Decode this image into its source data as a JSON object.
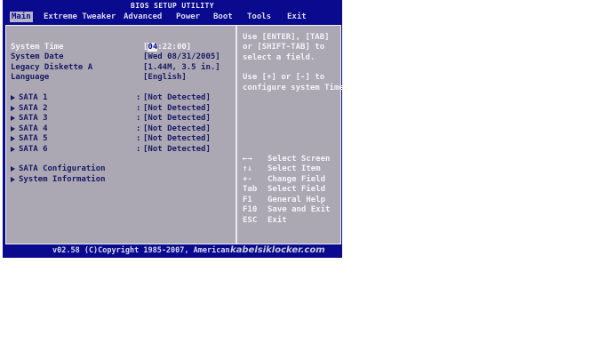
{
  "title": "BIOS SETUP UTILITY",
  "menu": [
    {
      "label": "Main",
      "active": true
    },
    {
      "label": "Extreme Tweaker"
    },
    {
      "label": "Advanced"
    },
    {
      "label": "Power"
    },
    {
      "label": "Boot"
    },
    {
      "label": "Tools"
    },
    {
      "label": "Exit"
    }
  ],
  "fields": {
    "system_time": {
      "label": "System Time",
      "value_cursor": "04",
      "value_rest": ":22:00]",
      "value_open": "["
    },
    "system_date": {
      "label": "System Date",
      "value": "[Wed 08/31/2005]"
    },
    "legacy_diskette": {
      "label": "Legacy Diskette A",
      "value": "[1.44M, 3.5 in.]"
    },
    "language": {
      "label": "Language",
      "value": "[English]"
    }
  },
  "sata": [
    {
      "label": "SATA 1",
      "value": "[Not Detected]"
    },
    {
      "label": "SATA 2",
      "value": "[Not Detected]"
    },
    {
      "label": "SATA 3",
      "value": "[Not Detected]"
    },
    {
      "label": "SATA 4",
      "value": "[Not Detected]"
    },
    {
      "label": "SATA 5",
      "value": "[Not Detected]"
    },
    {
      "label": "SATA 6",
      "value": "[Not Detected]"
    }
  ],
  "colon": ":",
  "submenus": [
    {
      "label": "SATA Configuration"
    },
    {
      "label": "System Information"
    }
  ],
  "help": {
    "lines": [
      "Use [ENTER], [TAB]",
      "or [SHIFT-TAB] to",
      "select a field.",
      "",
      "Use [+] or [-] to",
      "configure system Time."
    ]
  },
  "keys": [
    {
      "key": "←→",
      "desc": "Select Screen"
    },
    {
      "key": "↑↓",
      "desc": "Select Item"
    },
    {
      "key": "+-",
      "desc": "Change Field"
    },
    {
      "key": "Tab",
      "desc": "Select Field"
    },
    {
      "key": "F1",
      "desc": "General Help"
    },
    {
      "key": "F10",
      "desc": "Save and Exit"
    },
    {
      "key": "ESC",
      "desc": "Exit"
    }
  ],
  "footer": {
    "copyright": "v02.58 (C)Copyright 1985-2007, American",
    "watermark": "kabelsiklocker.com"
  },
  "colors": {
    "bios_blue": "#0a0a8e",
    "panel_gray": "#aba8b3",
    "text_white": "#f2f2f8",
    "text_navy": "#1a1a66"
  }
}
